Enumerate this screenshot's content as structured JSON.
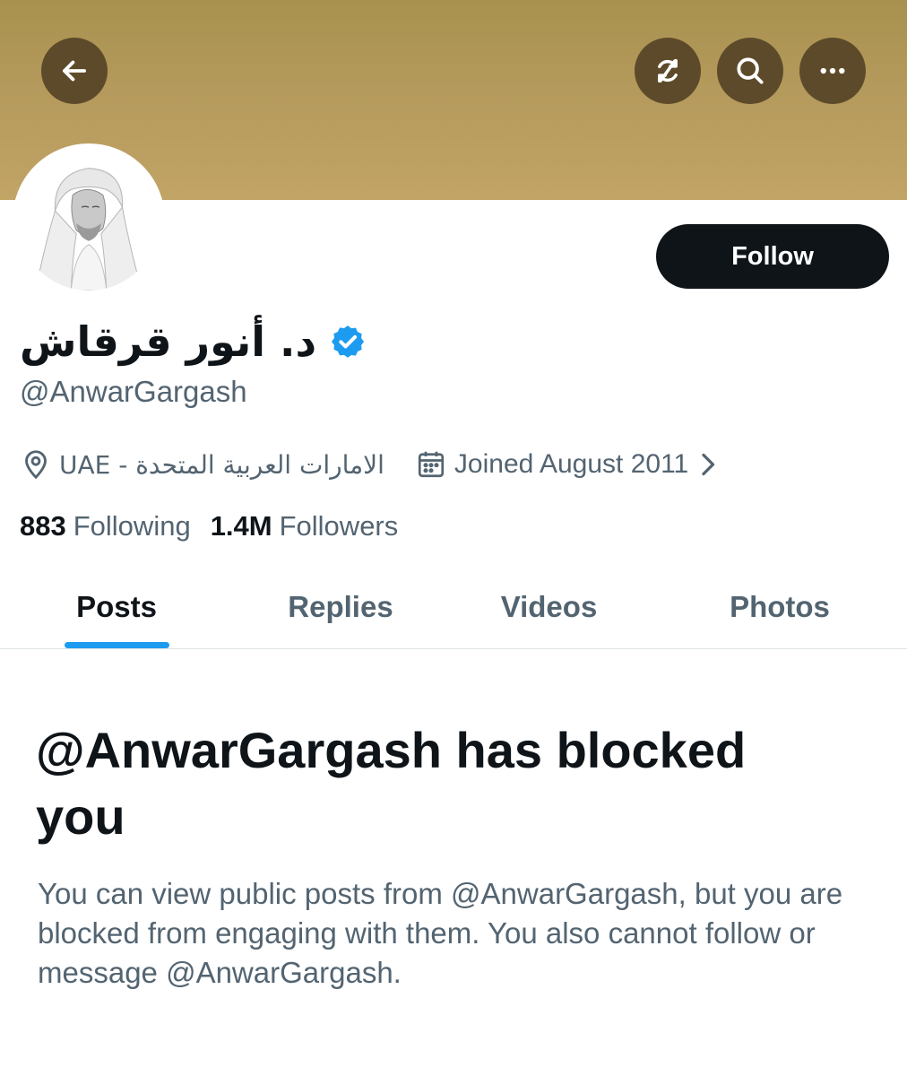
{
  "header": {
    "back_icon": "arrow-left-icon",
    "refresh_off_icon": "refresh-off-icon",
    "search_icon": "search-icon",
    "more_icon": "more-horizontal-icon",
    "banner_color": "#b49a5c",
    "button_color": "#5d4a2a"
  },
  "profile": {
    "display_name": "د. أنور قرقاش",
    "verified": true,
    "verified_color": "#1d9bf0",
    "handle": "@AnwarGargash",
    "location": "UAE - الامارات العربية المتحدة",
    "joined": "Joined August 2011",
    "following_count": "883",
    "following_label": "Following",
    "followers_count": "1.4M",
    "followers_label": "Followers",
    "follow_button": "Follow"
  },
  "tabs": [
    {
      "label": "Posts",
      "active": true
    },
    {
      "label": "Replies",
      "active": false
    },
    {
      "label": "Videos",
      "active": false
    },
    {
      "label": "Photos",
      "active": false
    }
  ],
  "blocked": {
    "title": "@AnwarGargash has blocked you",
    "description": "You can view public posts from @AnwarGargash, but you are blocked from engaging with them. You also cannot follow or message @AnwarGargash."
  }
}
